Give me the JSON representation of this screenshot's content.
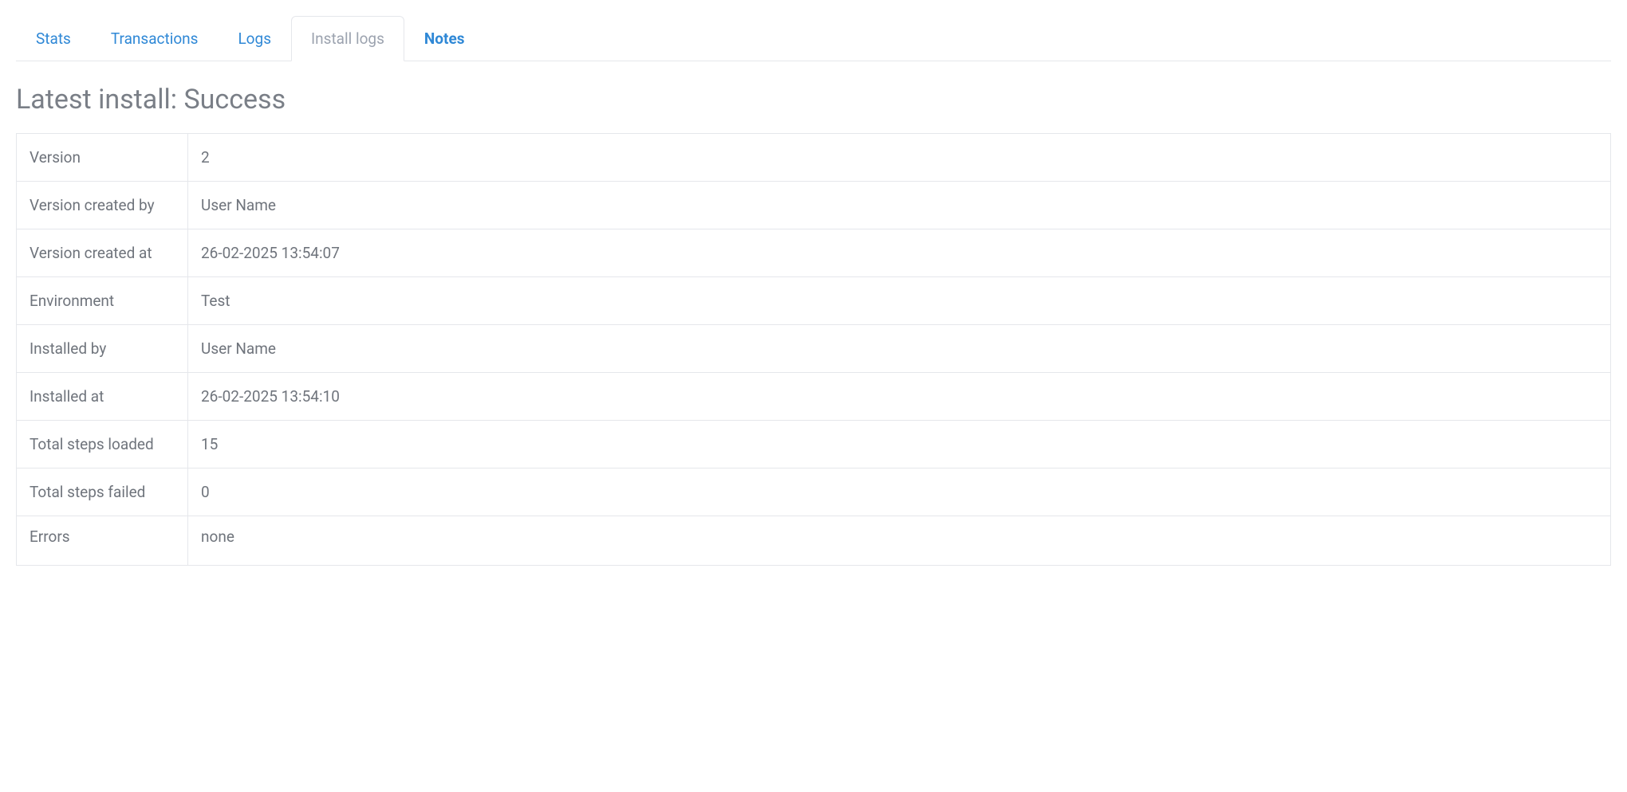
{
  "tabs": {
    "stats": "Stats",
    "transactions": "Transactions",
    "logs": "Logs",
    "install_logs": "Install logs",
    "notes": "Notes"
  },
  "page_title": "Latest install: Success",
  "details": {
    "version_label": "Version",
    "version_value": "2",
    "version_created_by_label": "Version created by",
    "version_created_by_value": "User Name",
    "version_created_at_label": "Version created at",
    "version_created_at_value": "26-02-2025 13:54:07",
    "environment_label": "Environment",
    "environment_value": "Test",
    "installed_by_label": "Installed by",
    "installed_by_value": "User Name",
    "installed_at_label": "Installed at",
    "installed_at_value": "26-02-2025 13:54:10",
    "total_steps_loaded_label": "Total steps loaded",
    "total_steps_loaded_value": "15",
    "total_steps_failed_label": "Total steps failed",
    "total_steps_failed_value": "0",
    "errors_label": "Errors",
    "errors_value": "none"
  }
}
